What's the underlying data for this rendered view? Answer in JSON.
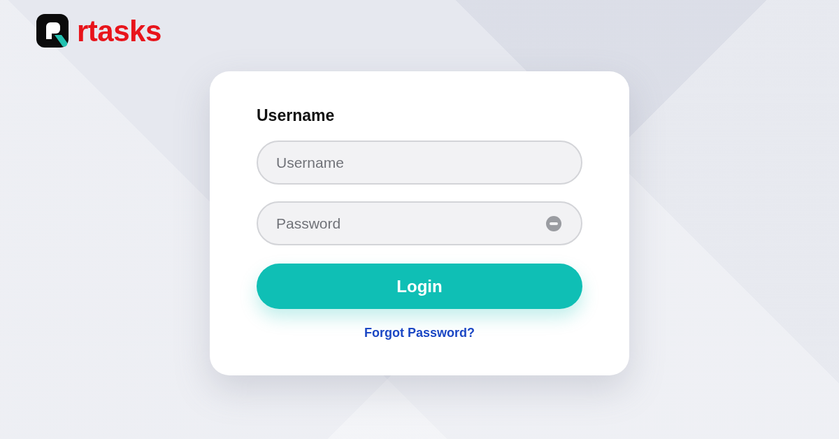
{
  "brand": {
    "name": "rtasks"
  },
  "login_form": {
    "heading": "Username",
    "username_field": {
      "placeholder": "Username"
    },
    "password_field": {
      "placeholder": "Password"
    },
    "login_button": "Login",
    "forgot_link": "Forgot Password?"
  }
}
